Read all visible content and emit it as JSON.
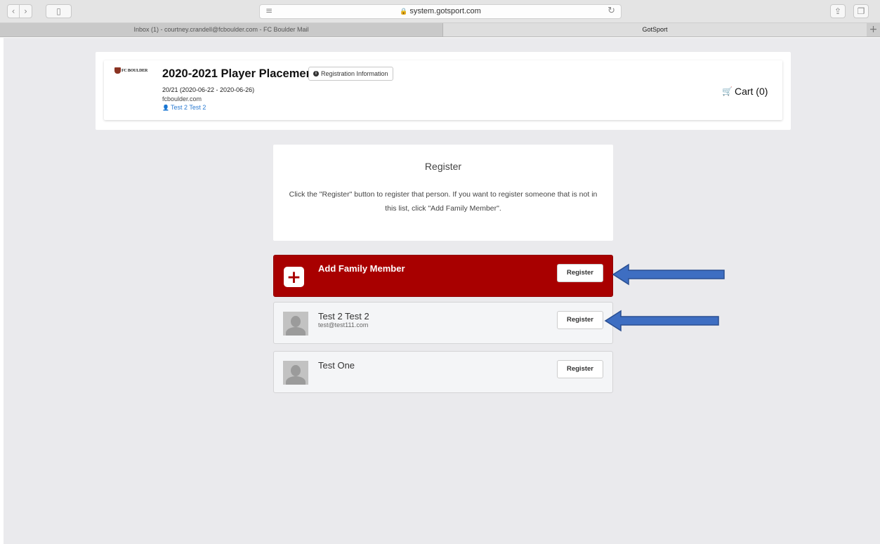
{
  "browser": {
    "url": "system.gotsport.com",
    "tabs": [
      {
        "label": "Inbox (1) - courtney.crandell@fcboulder.com - FC Boulder Mail"
      },
      {
        "label": "GotSport"
      }
    ]
  },
  "header": {
    "logo_text": "FC BOULDER",
    "title": "2020-2021 Player Placement",
    "info_button": "Registration Information",
    "dates": "20/21 (2020-06-22 - 2020-06-26)",
    "site": "fcboulder.com",
    "user": "Test 2 Test 2",
    "cart": "Cart (0)"
  },
  "register": {
    "title": "Register",
    "description": "Click the \"Register\" button to register that person. If you want to register someone that is not in this list, click \"Add Family Member\"."
  },
  "people": [
    {
      "name": "Add Family Member",
      "email": "",
      "button": "Register"
    },
    {
      "name": "Test 2 Test 2",
      "email": "test@test111.com",
      "button": "Register"
    },
    {
      "name": "Test One",
      "email": "",
      "button": "Register"
    }
  ],
  "colors": {
    "add_card": "#a80000",
    "arrow": "#3e6ec2",
    "link": "#2a7ad1"
  }
}
